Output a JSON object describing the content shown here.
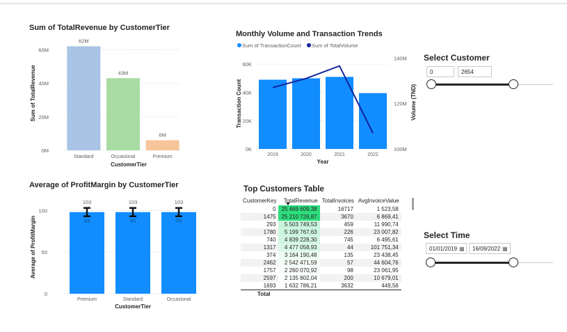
{
  "revenue_chart": {
    "title": "Sum of TotalRevenue by CustomerTier",
    "ylabel": "Sum of TotalRevenue",
    "xlabel": "CustomerTier",
    "yticks": [
      "0M",
      "20M",
      "40M",
      "60M"
    ],
    "categories": [
      "Standard",
      "Occasional",
      "Premium"
    ],
    "data_labels": [
      "62M",
      "43M",
      "6M"
    ],
    "colors": [
      "#a9c4e4",
      "#a9dca4",
      "#f7c59a"
    ]
  },
  "volume_chart": {
    "title": "Monthly Volume and Transaction Trends",
    "legend": [
      {
        "label": "Sum of TransactionCount",
        "color": "#118dff"
      },
      {
        "label": "Sum of TotalVolume",
        "color": "#12239e"
      }
    ],
    "yticks_left": [
      "0K",
      "20K",
      "40K",
      "60K"
    ],
    "yticks_right": [
      "100M",
      "120M",
      "140M"
    ],
    "ylabel_left": "Transaction Count",
    "ylabel_right": "Volume (TND)",
    "xlabel": "Year",
    "categories": [
      "2019",
      "2020",
      "2021",
      "2022"
    ]
  },
  "profit_chart": {
    "title": "Average of ProfitMargin by CustomerTier",
    "ylabel": "Average of ProfitMargin",
    "xlabel": "CustomerTier",
    "yticks": [
      "0",
      "50",
      "100"
    ],
    "categories": [
      "Premium",
      "Standard",
      "Occasional"
    ],
    "upper_labels": [
      "103",
      "103",
      "103"
    ],
    "lower_labels": [
      "93",
      "93",
      "93"
    ],
    "color": "#118dff"
  },
  "chart_data": [
    {
      "type": "bar",
      "title": "Sum of TotalRevenue by CustomerTier",
      "xlabel": "CustomerTier",
      "ylabel": "Sum of TotalRevenue",
      "categories": [
        "Standard",
        "Occasional",
        "Premium"
      ],
      "values": [
        62,
        43,
        6
      ],
      "ylim": [
        0,
        68
      ]
    },
    {
      "type": "bar",
      "title": "Monthly Volume and Transaction Trends",
      "xlabel": "Year",
      "categories": [
        "2019",
        "2020",
        "2021",
        "2022"
      ],
      "series": [
        {
          "name": "Sum of TransactionCount",
          "type": "bar",
          "axis": "left",
          "values": [
            49000,
            50000,
            51000,
            39500
          ]
        },
        {
          "name": "Sum of TotalVolume",
          "type": "line",
          "axis": "right",
          "values": [
            127000000,
            131000000,
            136500000,
            107000000
          ]
        }
      ],
      "ylim_left": [
        0,
        66000
      ],
      "ylim_right": [
        100000000,
        141000000
      ]
    },
    {
      "type": "bar",
      "title": "Average of ProfitMargin by CustomerTier",
      "xlabel": "CustomerTier",
      "ylabel": "Average of ProfitMargin",
      "categories": [
        "Premium",
        "Standard",
        "Occasional"
      ],
      "values": [
        98,
        98,
        98
      ],
      "error_low": [
        93,
        93,
        93
      ],
      "error_high": [
        103,
        103,
        103
      ],
      "ylim": [
        0,
        112
      ]
    }
  ],
  "customer_slicer": {
    "title": "Select Customer",
    "min_value": "0",
    "max_value": "2654"
  },
  "time_slicer": {
    "title": "Select Time",
    "start_date": "01/01/2019",
    "end_date": "16/09/2022",
    "calendar_icon": "calendar-icon"
  },
  "top_table": {
    "title": "Top Customers Table",
    "columns": [
      "CustomerKey",
      "TotalRevenue",
      "TotalInvoices",
      "AvgInvoiceValue"
    ],
    "rows": [
      [
        "0",
        "25 469 609,38",
        "16717",
        "1 523,58"
      ],
      [
        "1475",
        "25 210 726,87",
        "3670",
        "6 869,41"
      ],
      [
        "293",
        "5 503 749,53",
        "459",
        "11 990,74"
      ],
      [
        "1780",
        "5 199 767,63",
        "226",
        "23 007,82"
      ],
      [
        "740",
        "4 839 228,30",
        "745",
        "6 495,61"
      ],
      [
        "1317",
        "4 477 058,93",
        "44",
        "101 751,34"
      ],
      [
        "374",
        "3 164 190,48",
        "135",
        "23 438,45"
      ],
      [
        "2462",
        "2 542 471,59",
        "57",
        "44 604,76"
      ],
      [
        "1757",
        "2 260 070,92",
        "98",
        "23 061,95"
      ],
      [
        "2597",
        "2 135 802,04",
        "200",
        "10 679,01"
      ],
      [
        "1693",
        "1 632 786,21",
        "3632",
        "449,56"
      ]
    ],
    "revenue_shades": [
      "#2ddc7c",
      "#2ddc7c",
      "#c9f4dc",
      "#cdf5de",
      "#d3f6e2",
      "#d9f7e6",
      "#ecfbf3",
      "#f3fcf7",
      "#f8fdfa",
      "#fafefc",
      "#ffffff"
    ],
    "total_label": "Total"
  }
}
